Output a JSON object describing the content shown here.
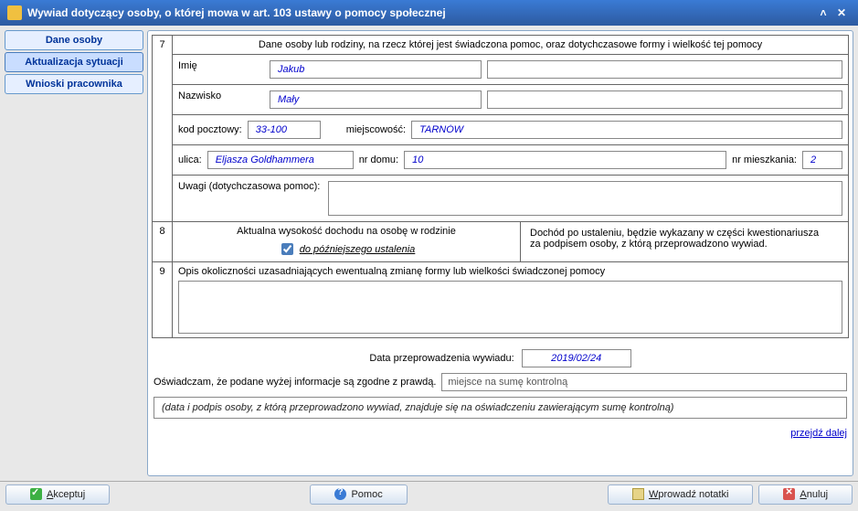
{
  "window": {
    "title": "Wywiad dotyczący osoby, o której mowa w art. 103 ustawy o pomocy społecznej"
  },
  "sidebar": {
    "items": [
      {
        "label": "Dane osoby"
      },
      {
        "label": "Aktualizacja sytuacji"
      },
      {
        "label": "Wnioski pracownika"
      }
    ]
  },
  "section7": {
    "num": "7",
    "header": "Dane osoby lub rodziny, na rzecz której jest świadczona pomoc, oraz dotychczasowe formy i wielkość tej pomocy",
    "labels": {
      "imie": "Imię",
      "nazwisko": "Nazwisko",
      "kod": "kod pocztowy:",
      "miejscowosc": "miejscowość:",
      "ulica": "ulica:",
      "nrdomu": "nr domu:",
      "nrm": "nr mieszkania:",
      "uwagi": "Uwagi (dotychczasowa pomoc):"
    },
    "values": {
      "imie": "Jakub",
      "imie2": "",
      "nazwisko": "Mały",
      "nazwisko2": "",
      "kod": "33-100",
      "miejscowosc": "TARNÓW",
      "ulica": "Eljasza Goldhammera",
      "nrdomu": "10",
      "nrm": "2",
      "uwagi": ""
    }
  },
  "section8": {
    "num": "8",
    "left_label": "Aktualna wysokość dochodu na osobę w rodzinie",
    "checkbox_label": "do późniejszego ustalenia",
    "checkbox_checked": true,
    "right_line1": "Dochód po ustaleniu, będzie wykazany w części kwestionariusza",
    "right_line2": "za podpisem osoby, z którą przeprowadzono wywiad."
  },
  "section9": {
    "num": "9",
    "header": "Opis okoliczności uzasadniających ewentualną zmianę formy lub wielkości świadczonej pomocy",
    "value": ""
  },
  "bottom": {
    "date_label": "Data przeprowadzenia wywiadu:",
    "date_value": "2019/02/24",
    "declaration_text": "Oświadczam, że podane wyżej informacje są zgodne z prawdą.",
    "checksum_placeholder": "miejsce na sumę kontrolną",
    "italic_note": "(data i podpis osoby, z którą przeprowadzono wywiad, znajduje się na oświadczeniu zawierającym sumę kontrolną)",
    "next_link": "przejdź dalej"
  },
  "footer": {
    "accept": "Akceptuj",
    "help": "Pomoc",
    "notes": "Wprowadź notatki",
    "cancel": "Anuluj"
  }
}
